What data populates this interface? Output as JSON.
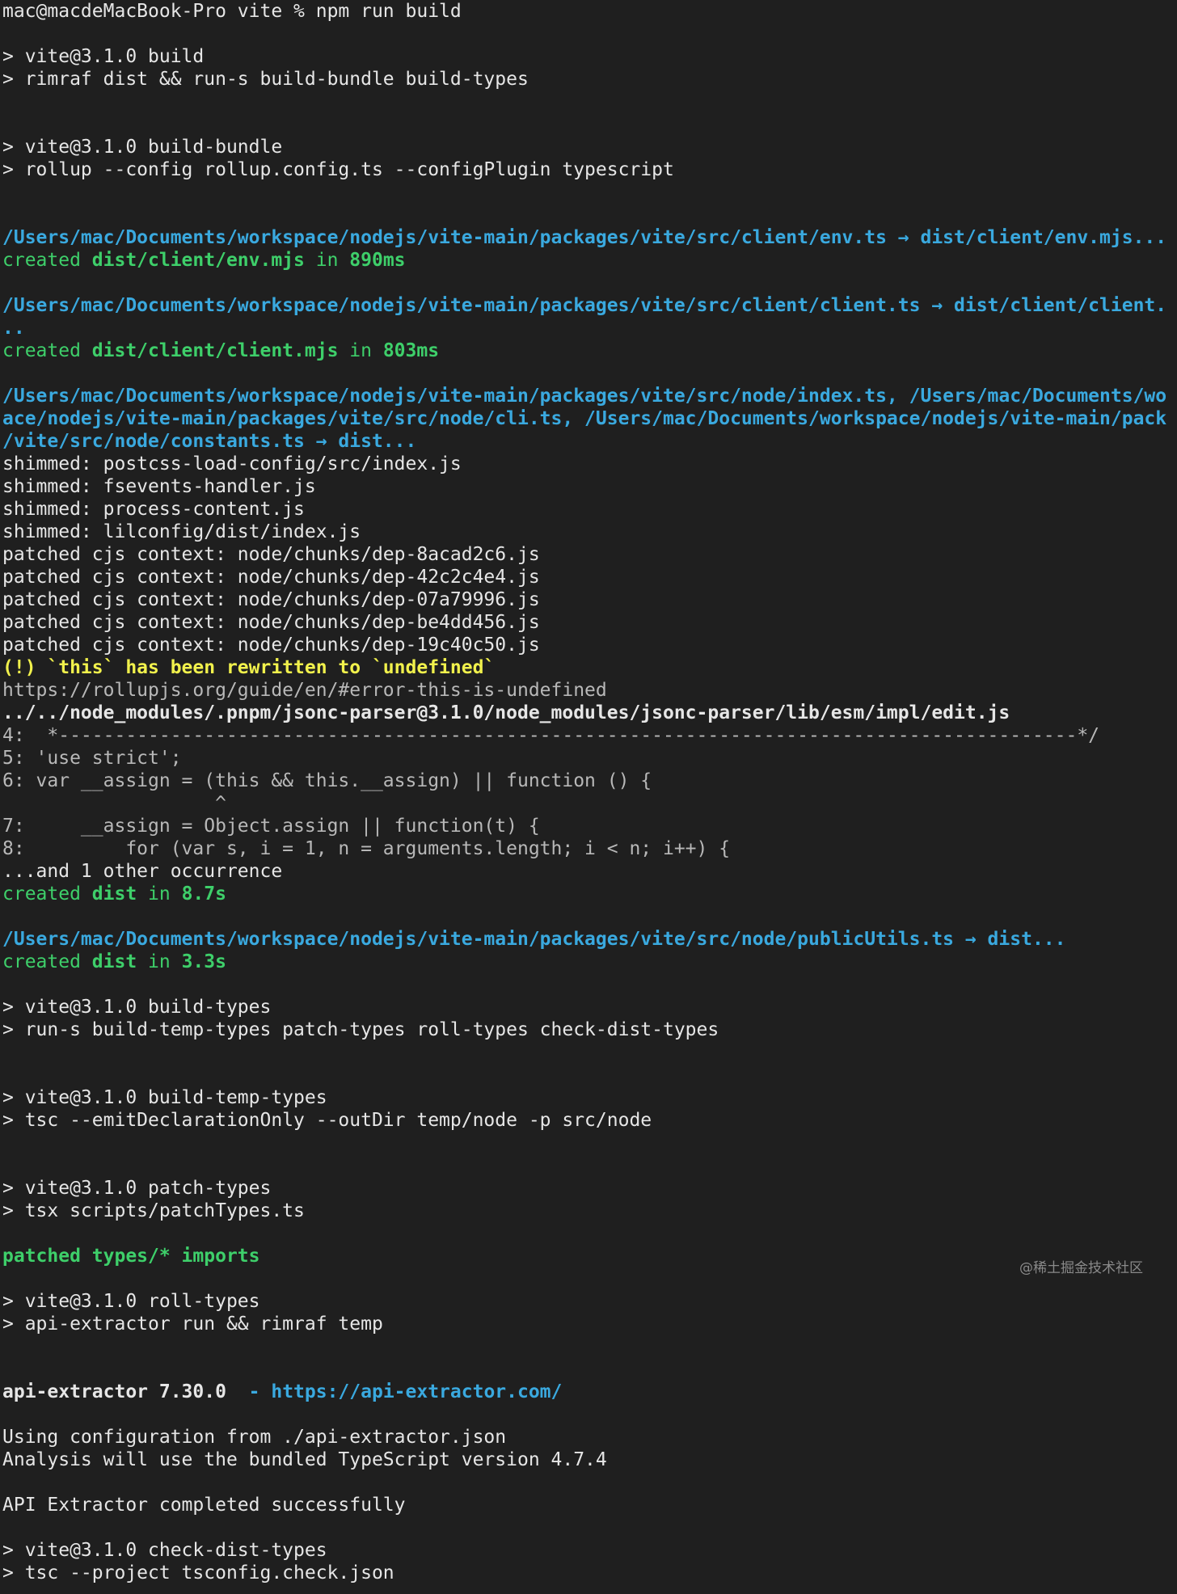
{
  "terminal": {
    "lines": [
      {
        "segments": [
          {
            "text": "mac@macdeMacBook-Pro vite % npm run build",
            "style": ""
          }
        ]
      },
      {
        "segments": [
          {
            "text": "> vite@3.1.0 build",
            "style": ""
          }
        ]
      },
      {
        "segments": [
          {
            "text": "> rimraf dist && run-s build-bundle build-types",
            "style": ""
          }
        ]
      },
      {
        "segments": [
          {
            "text": "> vite@3.1.0 build-bundle",
            "style": ""
          }
        ]
      },
      {
        "segments": [
          {
            "text": "> rollup --config rollup.config.ts --configPlugin typescript",
            "style": ""
          }
        ]
      },
      {
        "segments": [
          {
            "text": "/Users/mac/Documents/workspace/nodejs/vite-main/packages/vite/src/client/env.ts → dist/client/env.mjs...",
            "style": "blue"
          }
        ]
      },
      {
        "segments": [
          {
            "text": "created ",
            "style": "green"
          },
          {
            "text": "dist/client/env.mjs",
            "style": "green-b"
          },
          {
            "text": " in ",
            "style": "green"
          },
          {
            "text": "890ms",
            "style": "green-b"
          }
        ]
      },
      {
        "segments": [
          {
            "text": "/Users/mac/Documents/workspace/nodejs/vite-main/packages/vite/src/client/client.ts → dist/client/client.",
            "style": "blue"
          }
        ]
      },
      {
        "segments": [
          {
            "text": "..",
            "style": "blue"
          }
        ]
      },
      {
        "segments": [
          {
            "text": "created ",
            "style": "green"
          },
          {
            "text": "dist/client/client.mjs",
            "style": "green-b"
          },
          {
            "text": " in ",
            "style": "green"
          },
          {
            "text": "803ms",
            "style": "green-b"
          }
        ]
      },
      {
        "segments": [
          {
            "text": "/Users/mac/Documents/workspace/nodejs/vite-main/packages/vite/src/node/index.ts, /Users/mac/Documents/wo",
            "style": "blue"
          }
        ]
      },
      {
        "segments": [
          {
            "text": "ace/nodejs/vite-main/packages/vite/src/node/cli.ts, /Users/mac/Documents/workspace/nodejs/vite-main/pack",
            "style": "blue"
          }
        ]
      },
      {
        "segments": [
          {
            "text": "/vite/src/node/constants.ts → dist...",
            "style": "blue"
          }
        ]
      },
      {
        "segments": [
          {
            "text": "shimmed: postcss-load-config/src/index.js",
            "style": ""
          }
        ]
      },
      {
        "segments": [
          {
            "text": "shimmed: fsevents-handler.js",
            "style": ""
          }
        ]
      },
      {
        "segments": [
          {
            "text": "shimmed: process-content.js",
            "style": ""
          }
        ]
      },
      {
        "segments": [
          {
            "text": "shimmed: lilconfig/dist/index.js",
            "style": ""
          }
        ]
      },
      {
        "segments": [
          {
            "text": "patched cjs context: node/chunks/dep-8acad2c6.js",
            "style": ""
          }
        ]
      },
      {
        "segments": [
          {
            "text": "patched cjs context: node/chunks/dep-42c2c4e4.js",
            "style": ""
          }
        ]
      },
      {
        "segments": [
          {
            "text": "patched cjs context: node/chunks/dep-07a79996.js",
            "style": ""
          }
        ]
      },
      {
        "segments": [
          {
            "text": "patched cjs context: node/chunks/dep-be4dd456.js",
            "style": ""
          }
        ]
      },
      {
        "segments": [
          {
            "text": "patched cjs context: node/chunks/dep-19c40c50.js",
            "style": ""
          }
        ]
      },
      {
        "segments": [
          {
            "text": "(!) `this` has been rewritten to `undefined`",
            "style": "yellow-b"
          }
        ]
      },
      {
        "segments": [
          {
            "text": "https://rollupjs.org/guide/en/#error-this-is-undefined",
            "style": "gray"
          }
        ]
      },
      {
        "segments": [
          {
            "text": "../../node_modules/.pnpm/jsonc-parser@3.1.0/node_modules/jsonc-parser/lib/esm/impl/edit.js",
            "style": "bold"
          }
        ]
      },
      {
        "segments": [
          {
            "text": "4:  *-------------------------------------------------------------------------------------------*/",
            "style": "gray"
          }
        ]
      },
      {
        "segments": [
          {
            "text": "5: 'use strict';",
            "style": "gray"
          }
        ]
      },
      {
        "segments": [
          {
            "text": "6: var __assign = (this && this.__assign) || function () {",
            "style": "gray"
          }
        ]
      },
      {
        "segments": [
          {
            "text": "                   ^",
            "style": "gray"
          }
        ]
      },
      {
        "segments": [
          {
            "text": "7:     __assign = Object.assign || function(t) {",
            "style": "gray"
          }
        ]
      },
      {
        "segments": [
          {
            "text": "8:         for (var s, i = 1, n = arguments.length; i < n; i++) {",
            "style": "gray"
          }
        ]
      },
      {
        "segments": [
          {
            "text": "...and 1 other occurrence",
            "style": ""
          }
        ]
      },
      {
        "segments": [
          {
            "text": "created ",
            "style": "green"
          },
          {
            "text": "dist",
            "style": "green-b"
          },
          {
            "text": " in ",
            "style": "green"
          },
          {
            "text": "8.7s",
            "style": "green-b"
          }
        ]
      },
      {
        "segments": [
          {
            "text": "/Users/mac/Documents/workspace/nodejs/vite-main/packages/vite/src/node/publicUtils.ts → dist...",
            "style": "blue"
          }
        ]
      },
      {
        "segments": [
          {
            "text": "created ",
            "style": "green"
          },
          {
            "text": "dist",
            "style": "green-b"
          },
          {
            "text": " in ",
            "style": "green"
          },
          {
            "text": "3.3s",
            "style": "green-b"
          }
        ]
      },
      {
        "segments": [
          {
            "text": "> vite@3.1.0 build-types",
            "style": ""
          }
        ]
      },
      {
        "segments": [
          {
            "text": "> run-s build-temp-types patch-types roll-types check-dist-types",
            "style": ""
          }
        ]
      },
      {
        "segments": [
          {
            "text": "> vite@3.1.0 build-temp-types",
            "style": ""
          }
        ]
      },
      {
        "segments": [
          {
            "text": "> tsc --emitDeclarationOnly --outDir temp/node -p src/node",
            "style": ""
          }
        ]
      },
      {
        "segments": [
          {
            "text": "> vite@3.1.0 patch-types",
            "style": ""
          }
        ]
      },
      {
        "segments": [
          {
            "text": "> tsx scripts/patchTypes.ts",
            "style": ""
          }
        ]
      },
      {
        "segments": [
          {
            "text": "patched types/* imports",
            "style": "green-b"
          }
        ]
      },
      {
        "segments": [
          {
            "text": "> vite@3.1.0 roll-types",
            "style": ""
          }
        ]
      },
      {
        "segments": [
          {
            "text": "> api-extractor run && rimraf temp",
            "style": ""
          }
        ]
      },
      {
        "segments": [
          {
            "text": "api-extractor 7.30.0",
            "style": "bold"
          },
          {
            "text": "  - https://api-extractor.com/",
            "style": "blue"
          }
        ]
      },
      {
        "segments": [
          {
            "text": "Using configuration from ./api-extractor.json",
            "style": ""
          }
        ]
      },
      {
        "segments": [
          {
            "text": "Analysis will use the bundled TypeScript version 4.7.4",
            "style": ""
          }
        ]
      },
      {
        "segments": [
          {
            "text": "API Extractor completed successfully",
            "style": ""
          }
        ]
      },
      {
        "segments": [
          {
            "text": "> vite@3.1.0 check-dist-types",
            "style": ""
          }
        ]
      },
      {
        "segments": [
          {
            "text": "> tsc --project tsconfig.check.json",
            "style": ""
          }
        ]
      }
    ],
    "watermark": "@稀土掘金技术社区"
  }
}
